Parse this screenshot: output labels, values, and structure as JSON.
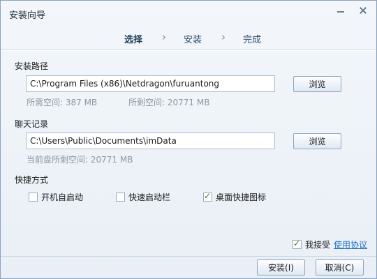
{
  "window": {
    "title": "安装向导",
    "minimize_label": "",
    "close_label": ""
  },
  "steps": {
    "items": [
      "选择",
      "安装",
      "完成"
    ],
    "active": 0,
    "separator": "›"
  },
  "install_path": {
    "label": "安装路径",
    "value": "C:\\Program Files (x86)\\Netdragon\\furuantong",
    "browse_label": "浏览",
    "required_space": "所需空间: 387 MB",
    "remaining_space": "所剩空间: 20771 MB"
  },
  "chat_log": {
    "label": "聊天记录",
    "value": "C:\\Users\\Public\\Documents\\imData",
    "browse_label": "浏览",
    "current_disk_space": "当前盘所剩空间: 20771 MB"
  },
  "shortcuts": {
    "label": "快捷方式",
    "options": [
      {
        "label": "开机自启动",
        "checked": false
      },
      {
        "label": "快速启动栏",
        "checked": false
      },
      {
        "label": "桌面快捷图标",
        "checked": true
      }
    ]
  },
  "agreement": {
    "accept_label": "我接受",
    "accepted": true,
    "link_label": "使用协议"
  },
  "buttons": {
    "install": "安装(I)",
    "cancel": "取消(C)"
  },
  "colors": {
    "window_bg": "#eef3f8",
    "link": "#1f6fc4",
    "info_text": "#8c97a2",
    "check_mark": "#2e7d1e"
  },
  "icons": {
    "minimize": "minimize-icon",
    "close": "close-icon",
    "step_separator": "chevron-right-icon",
    "check": "checkmark-icon"
  }
}
